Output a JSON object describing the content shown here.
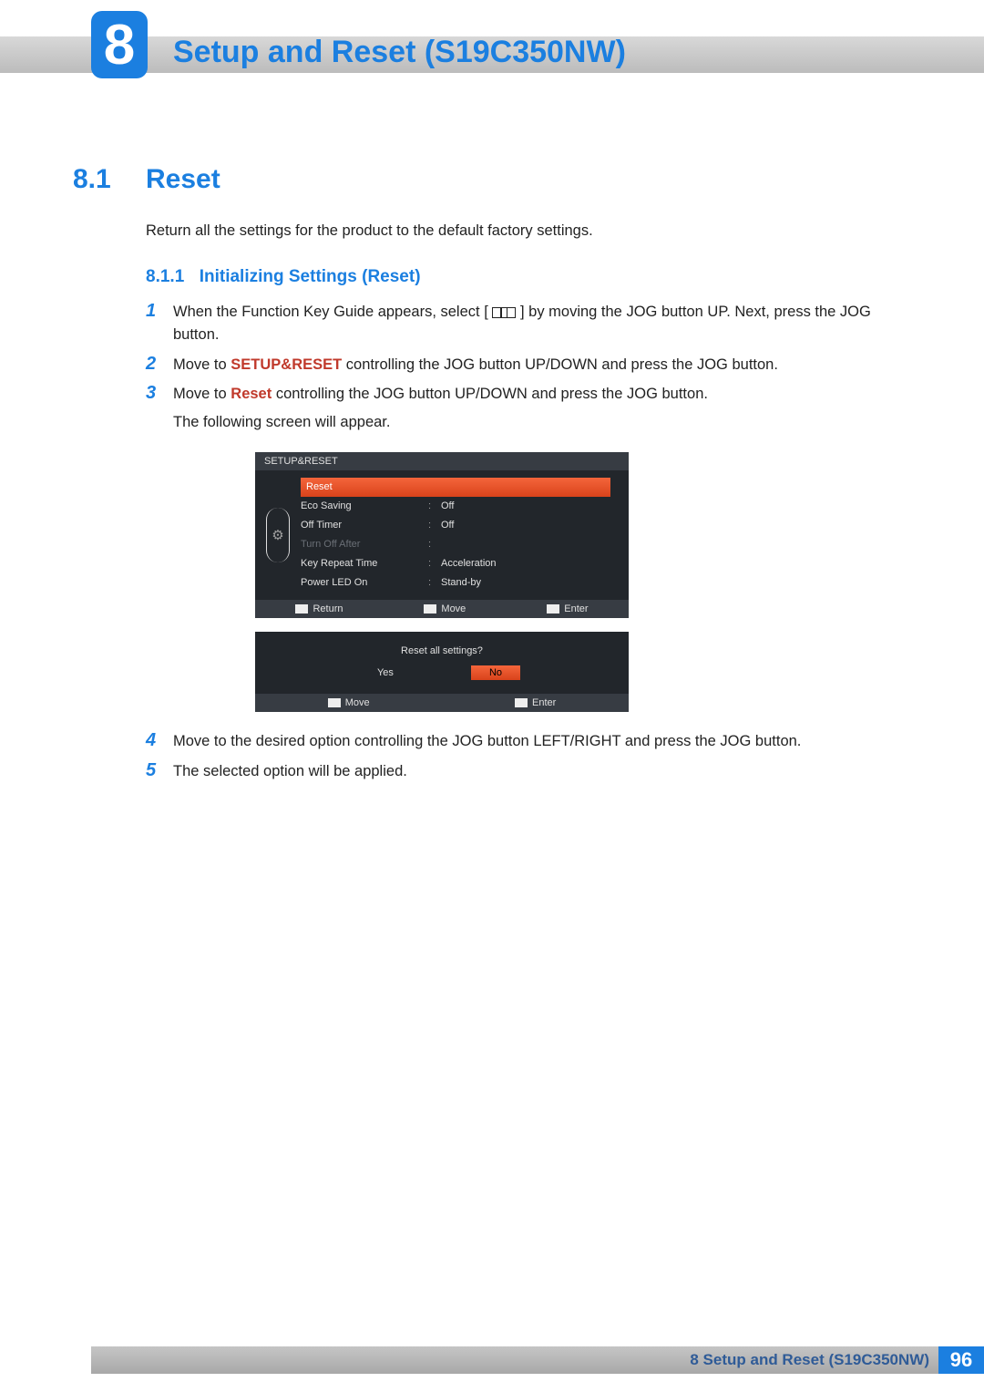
{
  "chapter": {
    "number": "8",
    "title": "Setup and Reset (S19C350NW)"
  },
  "section": {
    "number": "8.1",
    "title": "Reset"
  },
  "intro": "Return all the settings for the product to the default factory settings.",
  "subsection": {
    "number": "8.1.1",
    "title": "Initializing Settings (Reset)"
  },
  "steps": {
    "s1n": "1",
    "s1a": "When the Function Key Guide appears, select ",
    "s1b": " by moving the JOG button UP. Next, press the JOG button.",
    "s2n": "2",
    "s2a": "Move to ",
    "s2bold": "SETUP&RESET",
    "s2b": " controlling the JOG button UP/DOWN and press the JOG button.",
    "s3n": "3",
    "s3a": "Move to ",
    "s3bold": "Reset",
    "s3b": " controlling the JOG button UP/DOWN and press the JOG button.",
    "s3follow": "The following screen will appear.",
    "s4n": "4",
    "s4": "Move to the desired option controlling the JOG button LEFT/RIGHT and press the JOG button.",
    "s5n": "5",
    "s5": "The selected option will be applied."
  },
  "osd": {
    "header": "SETUP&RESET",
    "items": [
      {
        "label": "Reset",
        "value": "",
        "highlight": true
      },
      {
        "label": "Eco Saving",
        "value": "Off"
      },
      {
        "label": "Off Timer",
        "value": "Off"
      },
      {
        "label": "Turn Off After",
        "value": "",
        "disabled": true
      },
      {
        "label": "Key Repeat Time",
        "value": "Acceleration"
      },
      {
        "label": "Power LED On",
        "value": "Stand-by"
      }
    ],
    "hints": {
      "return": "Return",
      "move": "Move",
      "enter": "Enter"
    },
    "confirm": {
      "question": "Reset all settings?",
      "yes": "Yes",
      "no": "No"
    }
  },
  "footer": {
    "label": "8 Setup and Reset (S19C350NW)",
    "page": "96"
  }
}
